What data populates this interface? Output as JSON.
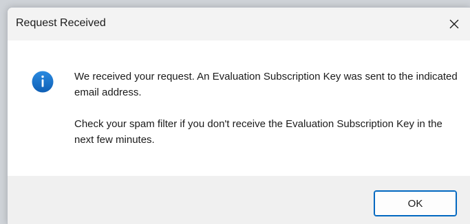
{
  "dialog": {
    "title": "Request Received",
    "close_icon": "close-icon",
    "icon": "info-icon",
    "message": {
      "paragraph1": "We received your request. An Evaluation Subscription Key was sent to the indicated email address.",
      "paragraph2": "Check your spam filter if you don't receive the Evaluation Subscription Key in the next few minutes."
    },
    "ok_label": "OK"
  },
  "colors": {
    "accent": "#0067c0",
    "info_icon": "#1a73c8",
    "titlebar_bg": "#f3f3f3",
    "footer_bg": "#f0f0f0"
  }
}
